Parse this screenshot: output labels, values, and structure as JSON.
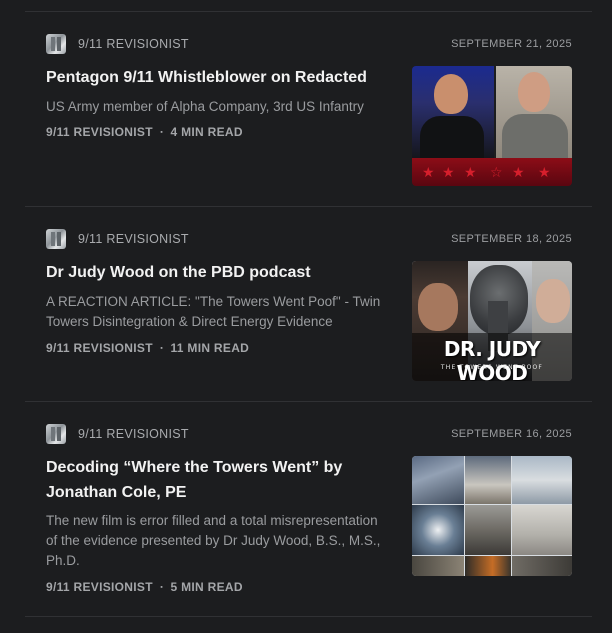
{
  "posts": [
    {
      "publication": "9/11 REVISIONIST",
      "date": "SEPTEMBER 21, 2025",
      "title": "Pentagon 9/11 Whistleblower on Redacted",
      "subtitle": "US Army member of Alpha Company, 3rd US Infantry",
      "author": "9/11 REVISIONIST",
      "separator": "∙",
      "read_time": "4 MIN READ"
    },
    {
      "publication": "9/11 REVISIONIST",
      "date": "SEPTEMBER 18, 2025",
      "title": "Dr Judy Wood on the PBD podcast",
      "subtitle": "A REACTION ARTICLE: \"The Towers Went Poof\" - Twin Towers Disintegration & Direct Energy Evidence",
      "author": "9/11 REVISIONIST",
      "separator": "∙",
      "read_time": "11 MIN READ",
      "thumb_caption": "DR. JUDY WOOD",
      "thumb_subcaption": "THE TOWERS WENT POOF"
    },
    {
      "publication": "9/11 REVISIONIST",
      "date": "SEPTEMBER 16, 2025",
      "title": "Decoding “Where the Towers Went” by Jonathan Cole, PE",
      "subtitle": "The new film is error filled and a total misrepresentation of the evidence presented by Dr Judy Wood, B.S., M.S., Ph.D.",
      "author": "9/11 REVISIONIST",
      "separator": "∙",
      "read_time": "5 MIN READ"
    }
  ],
  "colors": {
    "background": "#1c1d1f",
    "divider": "#303134",
    "title": "#f2f2f2",
    "muted": "#9a9c9f"
  }
}
